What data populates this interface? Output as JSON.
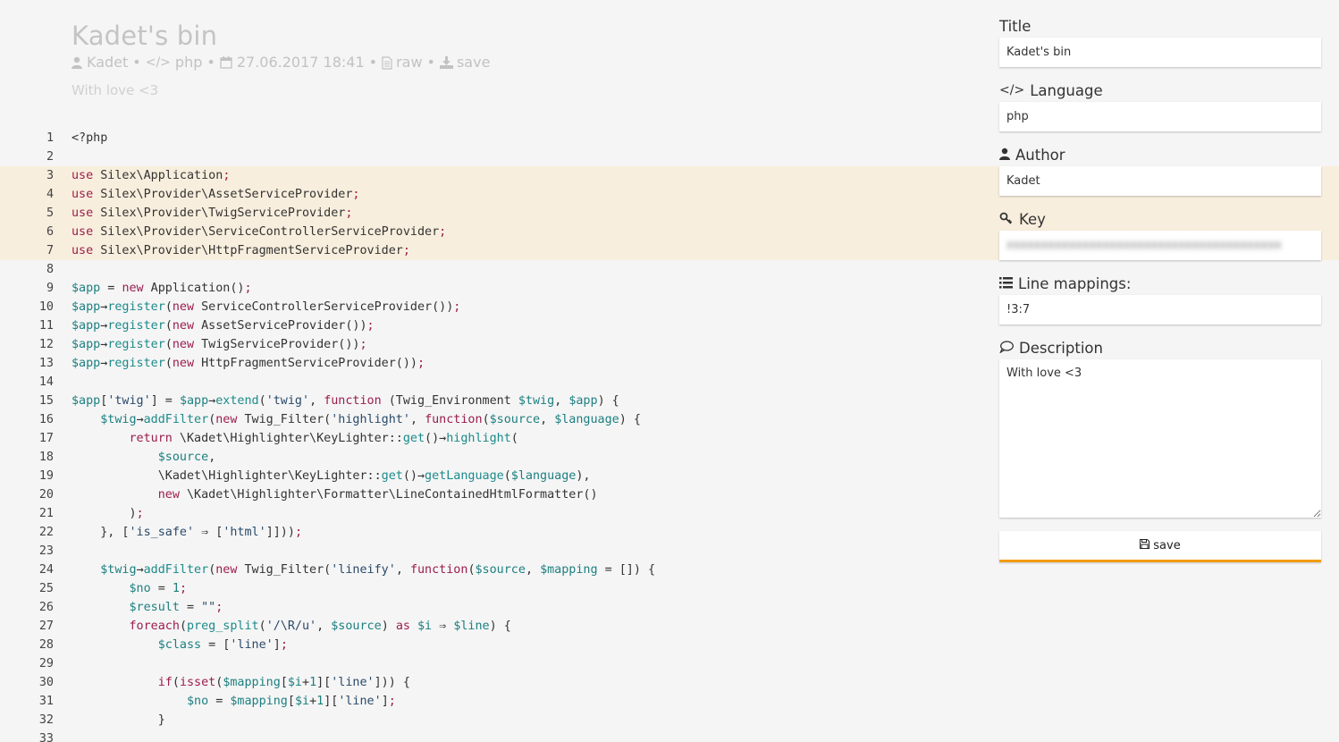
{
  "header": {
    "title": "Kadet's bin",
    "author": "Kadet",
    "language": "php",
    "date": "27.06.2017 18:41",
    "raw_label": "raw",
    "save_label": "save",
    "separator": "•",
    "description": "With love <3"
  },
  "code": {
    "highlighted_lines": [
      3,
      4,
      5,
      6,
      7
    ],
    "lines": [
      [
        {
          "t": "<?php"
        }
      ],
      [],
      [
        {
          "c": "k",
          "t": "use"
        },
        {
          "t": " Silex\\Application"
        },
        {
          "c": "p",
          "t": ";"
        }
      ],
      [
        {
          "c": "k",
          "t": "use"
        },
        {
          "t": " Silex\\Provider\\AssetServiceProvider"
        },
        {
          "c": "p",
          "t": ";"
        }
      ],
      [
        {
          "c": "k",
          "t": "use"
        },
        {
          "t": " Silex\\Provider\\TwigServiceProvider"
        },
        {
          "c": "p",
          "t": ";"
        }
      ],
      [
        {
          "c": "k",
          "t": "use"
        },
        {
          "t": " Silex\\Provider\\ServiceControllerServiceProvider"
        },
        {
          "c": "p",
          "t": ";"
        }
      ],
      [
        {
          "c": "k",
          "t": "use"
        },
        {
          "t": " Silex\\Provider\\HttpFragmentServiceProvider"
        },
        {
          "c": "p",
          "t": ";"
        }
      ],
      [],
      [
        {
          "c": "v",
          "t": "$app"
        },
        {
          "t": " = "
        },
        {
          "c": "k",
          "t": "new"
        },
        {
          "t": " Application()"
        },
        {
          "c": "p",
          "t": ";"
        }
      ],
      [
        {
          "c": "v",
          "t": "$app"
        },
        {
          "t": "→"
        },
        {
          "c": "f",
          "t": "register"
        },
        {
          "t": "("
        },
        {
          "c": "k",
          "t": "new"
        },
        {
          "t": " ServiceControllerServiceProvider())"
        },
        {
          "c": "p",
          "t": ";"
        }
      ],
      [
        {
          "c": "v",
          "t": "$app"
        },
        {
          "t": "→"
        },
        {
          "c": "f",
          "t": "register"
        },
        {
          "t": "("
        },
        {
          "c": "k",
          "t": "new"
        },
        {
          "t": " AssetServiceProvider())"
        },
        {
          "c": "p",
          "t": ";"
        }
      ],
      [
        {
          "c": "v",
          "t": "$app"
        },
        {
          "t": "→"
        },
        {
          "c": "f",
          "t": "register"
        },
        {
          "t": "("
        },
        {
          "c": "k",
          "t": "new"
        },
        {
          "t": " TwigServiceProvider())"
        },
        {
          "c": "p",
          "t": ";"
        }
      ],
      [
        {
          "c": "v",
          "t": "$app"
        },
        {
          "t": "→"
        },
        {
          "c": "f",
          "t": "register"
        },
        {
          "t": "("
        },
        {
          "c": "k",
          "t": "new"
        },
        {
          "t": " HttpFragmentServiceProvider())"
        },
        {
          "c": "p",
          "t": ";"
        }
      ],
      [],
      [
        {
          "c": "v",
          "t": "$app"
        },
        {
          "t": "["
        },
        {
          "c": "s",
          "t": "'twig'"
        },
        {
          "t": "] = "
        },
        {
          "c": "v",
          "t": "$app"
        },
        {
          "t": "→"
        },
        {
          "c": "f",
          "t": "extend"
        },
        {
          "t": "("
        },
        {
          "c": "s",
          "t": "'twig'"
        },
        {
          "t": ", "
        },
        {
          "c": "k",
          "t": "function"
        },
        {
          "t": " (Twig_Environment "
        },
        {
          "c": "v",
          "t": "$twig"
        },
        {
          "t": ", "
        },
        {
          "c": "v",
          "t": "$app"
        },
        {
          "t": ") {"
        }
      ],
      [
        {
          "t": "    "
        },
        {
          "c": "v",
          "t": "$twig"
        },
        {
          "t": "→"
        },
        {
          "c": "f",
          "t": "addFilter"
        },
        {
          "t": "("
        },
        {
          "c": "k",
          "t": "new"
        },
        {
          "t": " Twig_Filter("
        },
        {
          "c": "s",
          "t": "'highlight'"
        },
        {
          "t": ", "
        },
        {
          "c": "k",
          "t": "function"
        },
        {
          "t": "("
        },
        {
          "c": "v",
          "t": "$source"
        },
        {
          "t": ", "
        },
        {
          "c": "v",
          "t": "$language"
        },
        {
          "t": ") {"
        }
      ],
      [
        {
          "t": "        "
        },
        {
          "c": "k",
          "t": "return"
        },
        {
          "t": " \\Kadet\\Highlighter\\KeyLighter::"
        },
        {
          "c": "f",
          "t": "get"
        },
        {
          "t": "()→"
        },
        {
          "c": "f",
          "t": "highlight"
        },
        {
          "t": "("
        }
      ],
      [
        {
          "t": "            "
        },
        {
          "c": "v",
          "t": "$source"
        },
        {
          "t": ","
        }
      ],
      [
        {
          "t": "            \\Kadet\\Highlighter\\KeyLighter::"
        },
        {
          "c": "f",
          "t": "get"
        },
        {
          "t": "()→"
        },
        {
          "c": "f",
          "t": "getLanguage"
        },
        {
          "t": "("
        },
        {
          "c": "v",
          "t": "$language"
        },
        {
          "t": "),"
        }
      ],
      [
        {
          "t": "            "
        },
        {
          "c": "k",
          "t": "new"
        },
        {
          "t": " \\Kadet\\Highlighter\\Formatter\\LineContainedHtmlFormatter()"
        }
      ],
      [
        {
          "t": "        )"
        },
        {
          "c": "p",
          "t": ";"
        }
      ],
      [
        {
          "t": "    }, ["
        },
        {
          "c": "s",
          "t": "'is_safe'"
        },
        {
          "t": " ⇒ ["
        },
        {
          "c": "s",
          "t": "'html'"
        },
        {
          "t": "]]))"
        },
        {
          "c": "p",
          "t": ";"
        }
      ],
      [],
      [
        {
          "t": "    "
        },
        {
          "c": "v",
          "t": "$twig"
        },
        {
          "t": "→"
        },
        {
          "c": "f",
          "t": "addFilter"
        },
        {
          "t": "("
        },
        {
          "c": "k",
          "t": "new"
        },
        {
          "t": " Twig_Filter("
        },
        {
          "c": "s",
          "t": "'lineify'"
        },
        {
          "t": ", "
        },
        {
          "c": "k",
          "t": "function"
        },
        {
          "t": "("
        },
        {
          "c": "v",
          "t": "$source"
        },
        {
          "t": ", "
        },
        {
          "c": "v",
          "t": "$mapping"
        },
        {
          "t": " = []) {"
        }
      ],
      [
        {
          "t": "        "
        },
        {
          "c": "v",
          "t": "$no"
        },
        {
          "t": " = "
        },
        {
          "c": "n",
          "t": "1"
        },
        {
          "c": "p",
          "t": ";"
        }
      ],
      [
        {
          "t": "        "
        },
        {
          "c": "v",
          "t": "$result"
        },
        {
          "t": " = "
        },
        {
          "c": "s",
          "t": "\"\""
        },
        {
          "c": "p",
          "t": ";"
        }
      ],
      [
        {
          "t": "        "
        },
        {
          "c": "k",
          "t": "foreach"
        },
        {
          "t": "("
        },
        {
          "c": "f",
          "t": "preg_split"
        },
        {
          "t": "("
        },
        {
          "c": "s",
          "t": "'/\\R/u'"
        },
        {
          "t": ", "
        },
        {
          "c": "v",
          "t": "$source"
        },
        {
          "t": ") "
        },
        {
          "c": "k",
          "t": "as"
        },
        {
          "t": " "
        },
        {
          "c": "v",
          "t": "$i"
        },
        {
          "t": " ⇒ "
        },
        {
          "c": "v",
          "t": "$line"
        },
        {
          "t": ") {"
        }
      ],
      [
        {
          "t": "            "
        },
        {
          "c": "v",
          "t": "$class"
        },
        {
          "t": " = ["
        },
        {
          "c": "s",
          "t": "'line'"
        },
        {
          "t": "]"
        },
        {
          "c": "p",
          "t": ";"
        }
      ],
      [],
      [
        {
          "t": "            "
        },
        {
          "c": "k",
          "t": "if"
        },
        {
          "t": "("
        },
        {
          "c": "k",
          "t": "isset"
        },
        {
          "t": "("
        },
        {
          "c": "v",
          "t": "$mapping"
        },
        {
          "t": "["
        },
        {
          "c": "v",
          "t": "$i"
        },
        {
          "t": "+"
        },
        {
          "c": "n",
          "t": "1"
        },
        {
          "t": "]["
        },
        {
          "c": "s",
          "t": "'line'"
        },
        {
          "t": "])) {"
        }
      ],
      [
        {
          "t": "                "
        },
        {
          "c": "v",
          "t": "$no"
        },
        {
          "t": " = "
        },
        {
          "c": "v",
          "t": "$mapping"
        },
        {
          "t": "["
        },
        {
          "c": "v",
          "t": "$i"
        },
        {
          "t": "+"
        },
        {
          "c": "n",
          "t": "1"
        },
        {
          "t": "]["
        },
        {
          "c": "s",
          "t": "'line'"
        },
        {
          "t": "]"
        },
        {
          "c": "p",
          "t": ";"
        }
      ],
      [
        {
          "t": "            }"
        }
      ],
      []
    ]
  },
  "sidebar": {
    "title": {
      "label": "Title",
      "value": "Kadet's bin"
    },
    "language": {
      "label": "Language",
      "value": "php"
    },
    "author": {
      "label": "Author",
      "value": "Kadet"
    },
    "key": {
      "label": "Key",
      "value": "xxxxxxxxxxxxxxxxxxxxxxxxxxxxxxxxxxxxxxxx"
    },
    "mappings": {
      "label": "Line mappings:",
      "value": "!3:7"
    },
    "description": {
      "label": "Description",
      "value": "With love <3"
    },
    "save_button": "save"
  },
  "colors": {
    "accent": "#f39c12",
    "highlight_bg": "#f8eedd",
    "keyword": "#9b1d4e",
    "variable": "#1d7f80"
  }
}
